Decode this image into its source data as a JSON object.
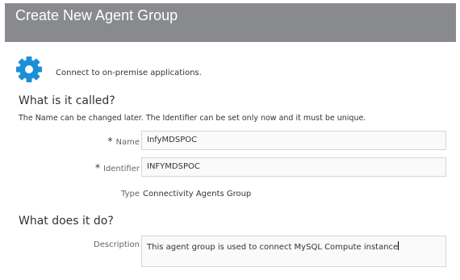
{
  "header": {
    "title": "Create New Agent Group"
  },
  "intro": {
    "icon": "gear-icon",
    "icon_color": "#1d8fd9",
    "text": "Connect to on-premise applications."
  },
  "section_identity": {
    "title": "What is it called?",
    "help": "The Name can be changed later. The Identifier can be set only now and it must be unique.",
    "name_label": "Name",
    "name_value": "InfyMDSPOC",
    "identifier_label": "Identifier",
    "identifier_value": "INFYMDSPOC",
    "required_marker": "*",
    "type_label": "Type",
    "type_value": "Connectivity Agents Group"
  },
  "section_purpose": {
    "title": "What does it do?",
    "description_label": "Description",
    "description_value": "This agent group is used to connect MySQL Compute instance"
  }
}
